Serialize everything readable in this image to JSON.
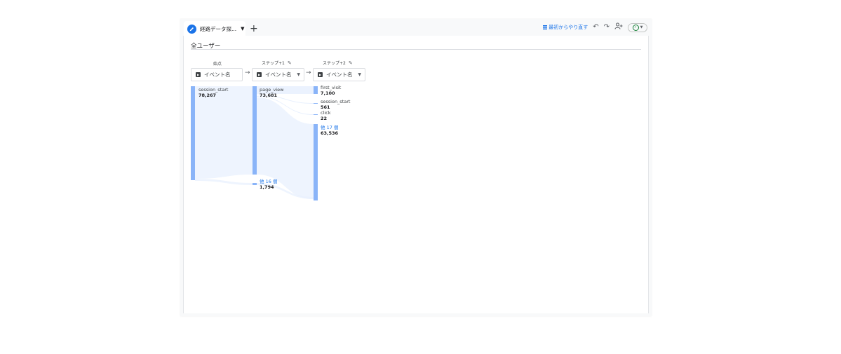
{
  "tab": {
    "title": "経路データ探...",
    "add_label": "+"
  },
  "toolbar": {
    "restart_label": "最初からやり直す"
  },
  "segment": {
    "label": "全ユーザー"
  },
  "steps": [
    {
      "header": "始点",
      "dimension": "イベント名"
    },
    {
      "header": "ステップ+1",
      "dimension": "イベント名"
    },
    {
      "header": "ステップ+2",
      "dimension": "イベント名"
    }
  ],
  "nodes": {
    "start": {
      "label": "session_start",
      "value": "78,267"
    },
    "s1_page_view": {
      "label": "page_view",
      "value": "73,681"
    },
    "s1_more": {
      "label": "他 16 個",
      "value": "1,794"
    },
    "s2_first_visit": {
      "label": "first_visit",
      "value": "7,100"
    },
    "s2_session_start": {
      "label": "session_start",
      "value": "561"
    },
    "s2_click": {
      "label": "click",
      "value": "22"
    },
    "s2_more": {
      "label": "他 17 個",
      "value": "63,536"
    }
  },
  "colors": {
    "node": "#8ab4f8",
    "link": "#e8f0fe",
    "accent": "#1a73e8"
  }
}
